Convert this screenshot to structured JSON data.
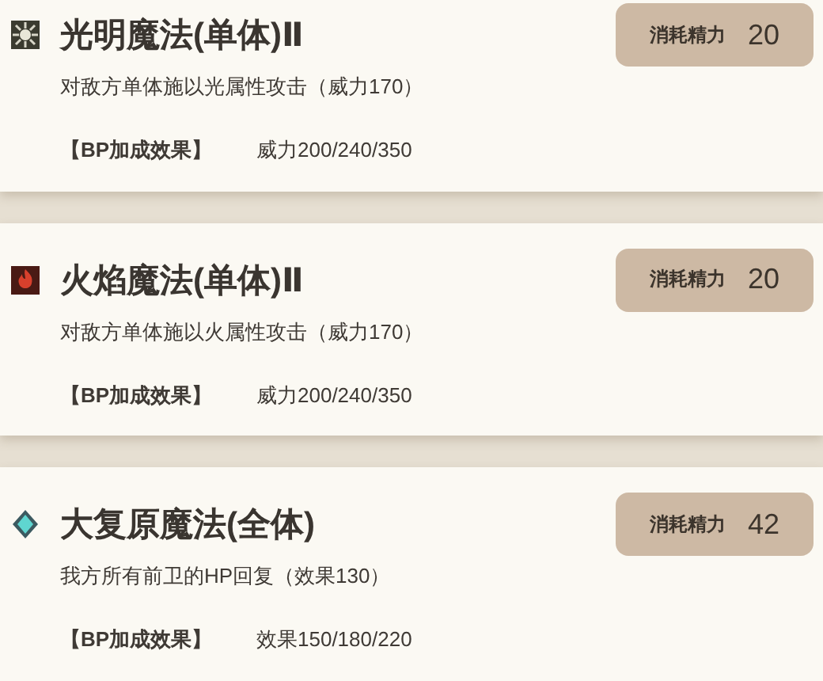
{
  "skills": [
    {
      "kind": "light",
      "name": "光明魔法(单体)Ⅱ",
      "cost_label": "消耗精力",
      "cost": "20",
      "description": "对敌方单体施以光属性攻击（威力170）",
      "bp_label": "【BP加成效果】",
      "bp_value": "威力200/240/350"
    },
    {
      "kind": "fire",
      "name": "火焰魔法(单体)Ⅱ",
      "cost_label": "消耗精力",
      "cost": "20",
      "description": "对敌方单体施以火属性攻击（威力170）",
      "bp_label": "【BP加成效果】",
      "bp_value": "威力200/240/350"
    },
    {
      "kind": "heal",
      "name": "大复原魔法(全体)",
      "cost_label": "消耗精力",
      "cost": "42",
      "description": "我方所有前卫的HP回复（效果130）",
      "bp_label": "【BP加成效果】",
      "bp_value": "效果150/180/220"
    }
  ]
}
